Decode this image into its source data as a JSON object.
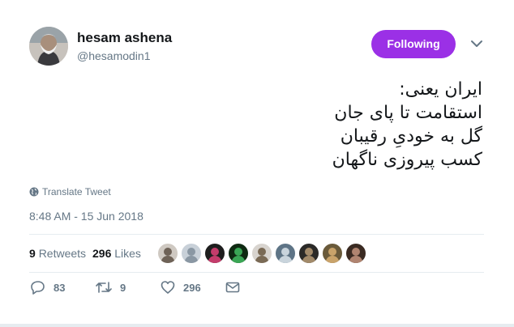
{
  "user": {
    "name": "hesam ashena",
    "handle": "@hesamodin1"
  },
  "follow_button": "Following",
  "tweet": {
    "lines": [
      "ایران یعنی:",
      "استقامت تا پای جان",
      "گل به خودیِ رقیبان",
      "کسب پیروزی ناگهان"
    ]
  },
  "translate_label": "Translate Tweet",
  "timestamp": "8:48 AM - 15 Jun 2018",
  "stats": {
    "retweets_count": "9",
    "retweets_label": "Retweets",
    "likes_count": "296",
    "likes_label": "Likes"
  },
  "liker_avatars": [
    {
      "bg": "#cfc9c2",
      "fg": "#6e6257"
    },
    {
      "bg": "#c8d0d8",
      "fg": "#8a97a3"
    },
    {
      "bg": "#1e1e1e",
      "fg": "#c43c6b"
    },
    {
      "bg": "#0f2a12",
      "fg": "#3aa655"
    },
    {
      "bg": "#d8d4cf",
      "fg": "#7a6a55"
    },
    {
      "bg": "#5e7486",
      "fg": "#c9d4dc"
    },
    {
      "bg": "#2b2a28",
      "fg": "#a28a6a"
    },
    {
      "bg": "#6a5a3a",
      "fg": "#c9a36a"
    },
    {
      "bg": "#3a2a22",
      "fg": "#b08470"
    }
  ],
  "actions": {
    "reply_count": "83",
    "retweet_count": "9",
    "like_count": "296"
  },
  "colors": {
    "accent": "#9b30e6",
    "secondary_text": "#657786",
    "primary_text": "#14171a",
    "border": "#e6ecf0"
  }
}
